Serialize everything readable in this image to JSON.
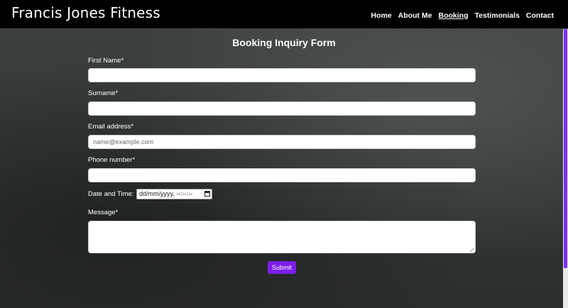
{
  "header": {
    "brand": "Francis Jones Fitness",
    "nav": [
      "Home",
      "About Me",
      "Booking",
      "Testimonials",
      "Contact"
    ],
    "active": "Booking"
  },
  "form": {
    "title": "Booking Inquiry Form",
    "first_name_label": "First Name*",
    "surname_label": "Surname*",
    "email_label": "Email address*",
    "email_placeholder": "name@example.com",
    "phone_label": "Phone number*",
    "datetime_label": "Date and Time:",
    "datetime_placeholder": "dd/mm/yyyy, --:--:--",
    "message_label": "Message*",
    "submit_label": "Submit"
  },
  "colors": {
    "accent": "#7b1fe8",
    "navbar": "#000000"
  }
}
